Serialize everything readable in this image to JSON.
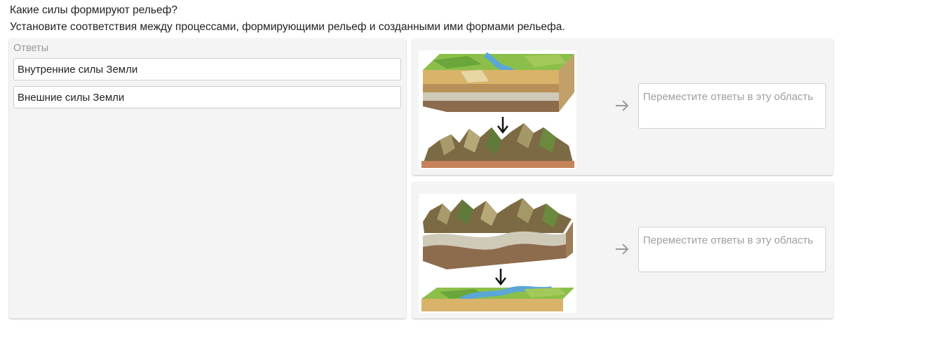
{
  "question": {
    "title": "Какие силы формируют рельеф?",
    "instruction": "Установите соответствия между процессами, формирующими рельеф и созданными ими формами рельефа."
  },
  "answers": {
    "title": "Ответы",
    "items": [
      {
        "label": "Внутренние силы Земли"
      },
      {
        "label": "Внешние силы Земли"
      }
    ]
  },
  "matches": [
    {
      "illustration": "plain-to-mountains-diagram",
      "arrow_icon": "arrow-right-icon",
      "drop_placeholder": "Переместите ответы в эту область"
    },
    {
      "illustration": "mountains-to-plain-diagram",
      "arrow_icon": "arrow-right-icon",
      "drop_placeholder": "Переместите ответы в эту область"
    }
  ],
  "colors": {
    "panel_bg": "#f4f4f4",
    "border": "#cfcfcf",
    "placeholder_text": "#9e9e9e",
    "muted_title": "#9a9a9a",
    "arrow": "#999999"
  }
}
